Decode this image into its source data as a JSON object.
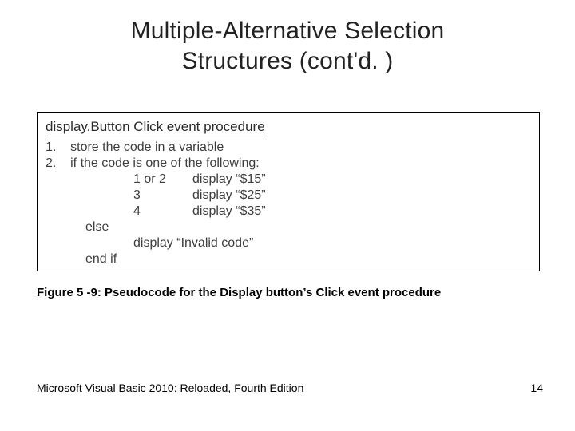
{
  "title_line1": "Multiple-Alternative Selection",
  "title_line2": "Structures (cont'd. )",
  "proc_title": "display.Button Click event procedure",
  "lines": {
    "l1": "1.    store the code in a variable",
    "l2": "2.    if the code is one of the following:",
    "p1a": "1 or 2",
    "p1b": "display “$15”",
    "p2a": "3",
    "p2b": "display “$25”",
    "p3a": "4",
    "p3b": "display “$35”",
    "else": "else",
    "inv": "display “Invalid code”",
    "endif": "end if"
  },
  "caption": "Figure 5 -9: Pseudocode for the Display button’s Click event procedure",
  "footer_left": "Microsoft Visual Basic 2010: Reloaded, Fourth Edition",
  "page_number": "14"
}
